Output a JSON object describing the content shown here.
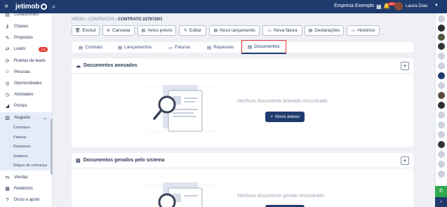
{
  "topbar": {
    "close_icon": "×",
    "logo_text": "jetimob",
    "company": "Empresa Exemplo",
    "notification_count": "99+",
    "user_name": "Laura Dias"
  },
  "sidebar": {
    "items": [
      {
        "label": "Condomínios",
        "icon": "▤"
      },
      {
        "label": "Chaves",
        "icon": "⚷"
      },
      {
        "label": "Propostas",
        "icon": "✎"
      },
      {
        "label": "Leads",
        "icon": "⇄",
        "badge": "378"
      },
      {
        "label": "Roletas de leads",
        "icon": "⟳"
      },
      {
        "label": "Pessoas",
        "icon": "☺"
      },
      {
        "label": "Oportunidades",
        "icon": "◎"
      },
      {
        "label": "Atividades",
        "icon": "◷"
      },
      {
        "label": "Portais",
        "icon": "◢"
      },
      {
        "label": "Aluguéis",
        "icon": "▥"
      }
    ],
    "subitems": [
      "Contratos",
      "Faturas",
      "Repasses",
      "Análises",
      "Régua de cobrança"
    ],
    "bottom_items": [
      {
        "label": "Vendas",
        "icon": "⇆"
      },
      {
        "label": "Relatórios",
        "icon": "▦"
      },
      {
        "label": "Dicas e apoio",
        "icon": "?"
      }
    ]
  },
  "breadcrumb": {
    "home": "INÍCIO",
    "sep": "›",
    "contracts": "CONTRATOS",
    "current": "CONTRATO 2276720/1"
  },
  "actions": [
    {
      "label": "Excluir",
      "icon": "🗑"
    },
    {
      "label": "Cancelar",
      "icon": "⊘"
    },
    {
      "label": "Aviso prévio",
      "icon": "▤"
    },
    {
      "label": "Editar",
      "icon": "✎"
    },
    {
      "label": "Novo lançamento",
      "icon": "▤"
    },
    {
      "label": "Nova fatura",
      "icon": "▭"
    },
    {
      "label": "Declarações",
      "icon": "▤"
    },
    {
      "label": "Histórico",
      "icon": "▭"
    }
  ],
  "tabs": [
    {
      "label": "Contrato",
      "icon": "▤"
    },
    {
      "label": "Lançamentos",
      "icon": "▤"
    },
    {
      "label": "Faturas",
      "icon": "▭"
    },
    {
      "label": "Repasses",
      "icon": "▤"
    },
    {
      "label": "Documentos",
      "icon": "▤"
    }
  ],
  "attached": {
    "title": "Documentos anexados",
    "empty": "Nenhum documento anexado encontrado.",
    "button": "Novo anexo"
  },
  "generated": {
    "title": "Documentos gerados pelo sistema",
    "empty": "Nenhum documento gerado encontrado."
  },
  "colors": {
    "brand": "#1f3b6e",
    "accent": "#e53935",
    "success": "#2fa84f"
  }
}
